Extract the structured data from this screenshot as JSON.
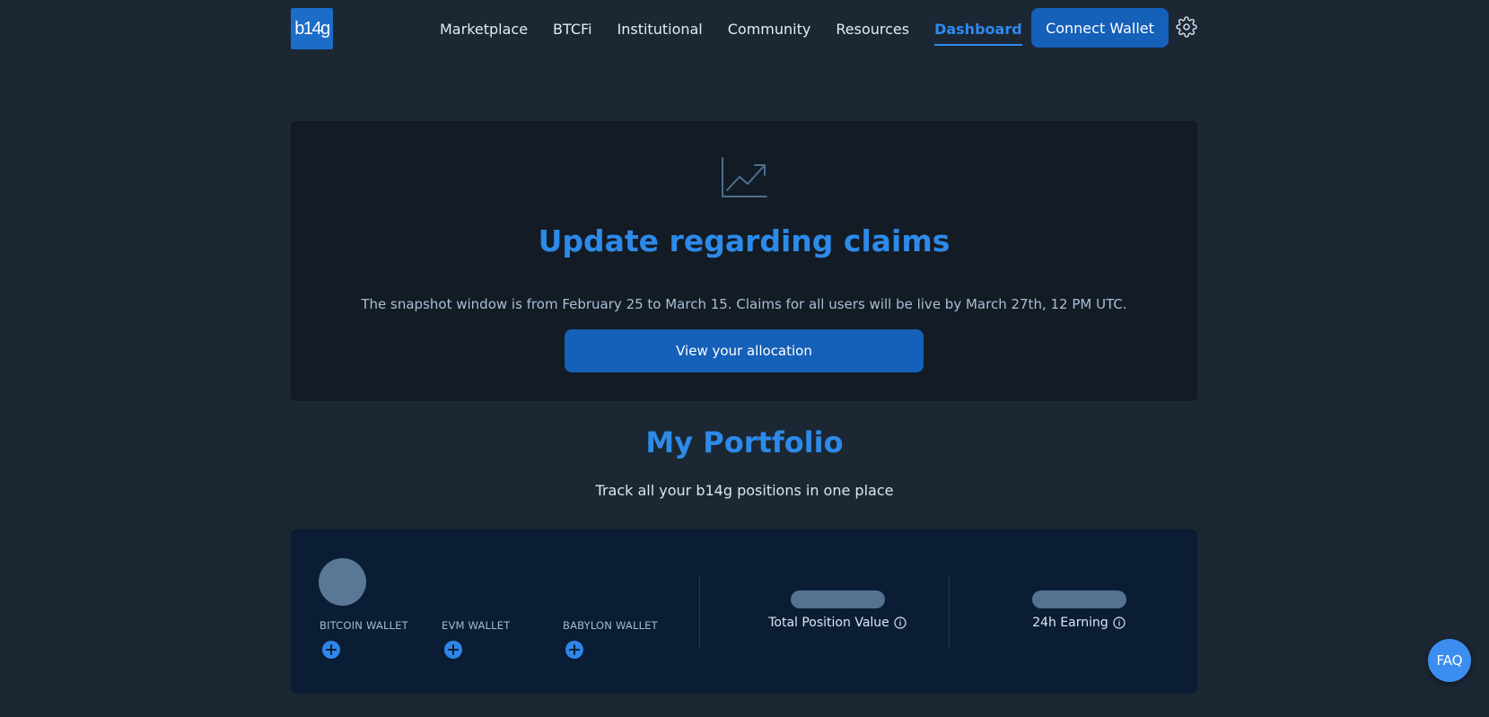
{
  "nav": {
    "logo_text": "b14g",
    "links": [
      "Marketplace",
      "BTCFi",
      "Institutional",
      "Community",
      "Resources",
      "Dashboard"
    ],
    "active": "Dashboard",
    "connect_label": "Connect Wallet",
    "settings_icon": "gear-icon"
  },
  "banner": {
    "icon": "trending-up-icon",
    "title": "Update regarding claims",
    "text": "The snapshot window is from February 25 to March 15. Claims for all users will be live by March 27th, 12 PM UTC.",
    "button_label": "View your allocation"
  },
  "portfolio": {
    "title": "My Portfolio",
    "subtitle": "Track all your b14g positions in one place",
    "wallets": [
      "BITCOIN WALLET",
      "EVM WALLET",
      "BABYLON WALLET"
    ],
    "total_label": "Total Position Value",
    "earning_label": "24h Earning"
  },
  "faq_label": "FAQ",
  "colors": {
    "accent": "#2d8ae8",
    "button": "#1560b8",
    "background": "#1b2733",
    "card": "#0a1d35"
  }
}
